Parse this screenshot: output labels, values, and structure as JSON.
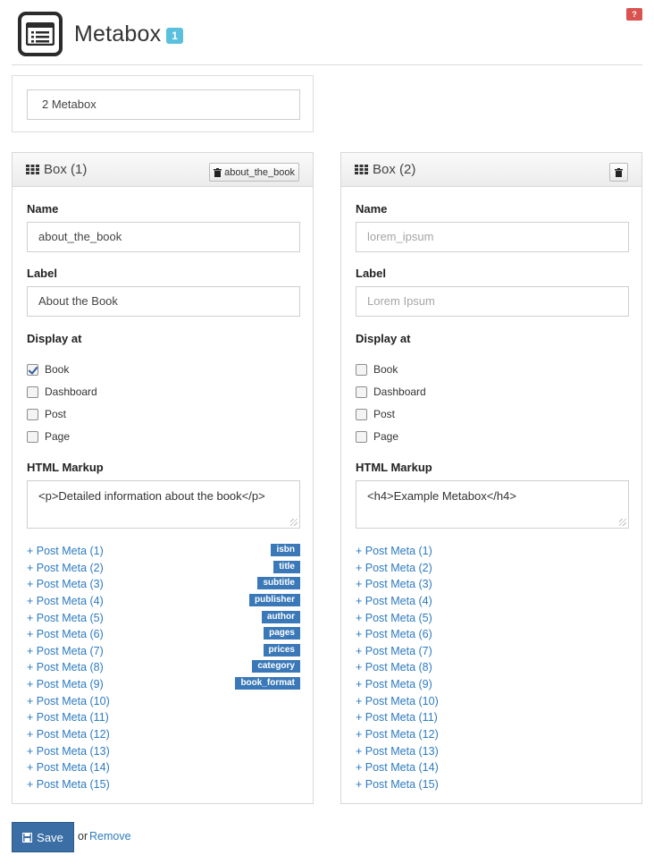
{
  "help_badge": "?",
  "header": {
    "title": "Metabox",
    "count_badge": "1"
  },
  "count_select": {
    "value": "2 Metabox"
  },
  "labels": {
    "name": "Name",
    "label": "Label",
    "display_at": "Display at",
    "html_markup": "HTML Markup"
  },
  "boxes": [
    {
      "title": "Box (1)",
      "delete_button_label": "about_the_book",
      "name_value": "about_the_book",
      "label_value": "About the Book",
      "display_options": [
        {
          "label": "Book",
          "checked": true
        },
        {
          "label": "Dashboard",
          "checked": false
        },
        {
          "label": "Post",
          "checked": false
        },
        {
          "label": "Page",
          "checked": false
        }
      ],
      "html_markup": "<p>Detailed information about the book</p>",
      "post_meta": [
        {
          "label": "+ Post Meta (1)",
          "tag": "isbn"
        },
        {
          "label": "+ Post Meta (2)",
          "tag": "title"
        },
        {
          "label": "+ Post Meta (3)",
          "tag": "subtitle"
        },
        {
          "label": "+ Post Meta (4)",
          "tag": "publisher"
        },
        {
          "label": "+ Post Meta (5)",
          "tag": "author"
        },
        {
          "label": "+ Post Meta (6)",
          "tag": "pages"
        },
        {
          "label": "+ Post Meta (7)",
          "tag": "prices"
        },
        {
          "label": "+ Post Meta (8)",
          "tag": "category"
        },
        {
          "label": "+ Post Meta (9)",
          "tag": "book_format"
        },
        {
          "label": "+ Post Meta (10)",
          "tag": ""
        },
        {
          "label": "+ Post Meta (11)",
          "tag": ""
        },
        {
          "label": "+ Post Meta (12)",
          "tag": ""
        },
        {
          "label": "+ Post Meta (13)",
          "tag": ""
        },
        {
          "label": "+ Post Meta (14)",
          "tag": ""
        },
        {
          "label": "+ Post Meta (15)",
          "tag": ""
        }
      ]
    },
    {
      "title": "Box (2)",
      "delete_button_label": "",
      "name_placeholder": "lorem_ipsum",
      "label_placeholder": "Lorem Ipsum",
      "display_options": [
        {
          "label": "Book",
          "checked": false
        },
        {
          "label": "Dashboard",
          "checked": false
        },
        {
          "label": "Post",
          "checked": false
        },
        {
          "label": "Page",
          "checked": false
        }
      ],
      "html_markup": "<h4>Example Metabox</h4>",
      "post_meta": [
        {
          "label": "+ Post Meta (1)",
          "tag": ""
        },
        {
          "label": "+ Post Meta (2)",
          "tag": ""
        },
        {
          "label": "+ Post Meta (3)",
          "tag": ""
        },
        {
          "label": "+ Post Meta (4)",
          "tag": ""
        },
        {
          "label": "+ Post Meta (5)",
          "tag": ""
        },
        {
          "label": "+ Post Meta (6)",
          "tag": ""
        },
        {
          "label": "+ Post Meta (7)",
          "tag": ""
        },
        {
          "label": "+ Post Meta (8)",
          "tag": ""
        },
        {
          "label": "+ Post Meta (9)",
          "tag": ""
        },
        {
          "label": "+ Post Meta (10)",
          "tag": ""
        },
        {
          "label": "+ Post Meta (11)",
          "tag": ""
        },
        {
          "label": "+ Post Meta (12)",
          "tag": ""
        },
        {
          "label": "+ Post Meta (13)",
          "tag": ""
        },
        {
          "label": "+ Post Meta (14)",
          "tag": ""
        },
        {
          "label": "+ Post Meta (15)",
          "tag": ""
        }
      ]
    }
  ],
  "footer": {
    "save_label": "Save",
    "or_text": "or",
    "remove_label": "Remove"
  },
  "colors": {
    "accent": "#2e7bbf",
    "badge": "#5bc0de",
    "tag": "#3a78b8",
    "save": "#3a6ea5",
    "help": "#d9534f"
  }
}
